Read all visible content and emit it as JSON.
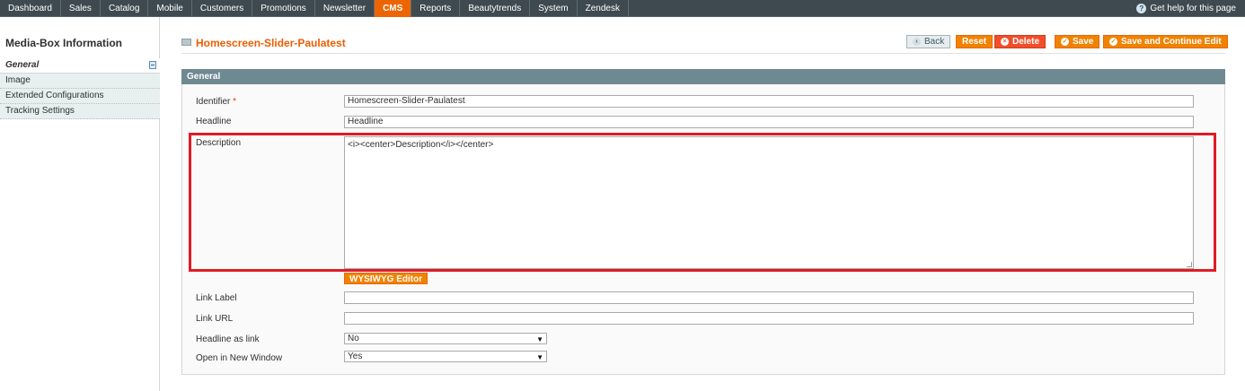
{
  "nav": {
    "items": [
      "Dashboard",
      "Sales",
      "Catalog",
      "Mobile",
      "Customers",
      "Promotions",
      "Newsletter",
      "CMS",
      "Reports",
      "Beautytrends",
      "System",
      "Zendesk"
    ],
    "active": "CMS",
    "help": "Get help for this page"
  },
  "sidebar": {
    "title": "Media-Box Information",
    "tabs": [
      "General",
      "Image",
      "Extended Configurations",
      "Tracking Settings"
    ]
  },
  "header": {
    "title": "Homescreen-Slider-Paulatest",
    "buttons": {
      "back": "Back",
      "reset": "Reset",
      "delete": "Delete",
      "save": "Save",
      "save_continue": "Save and Continue Edit"
    }
  },
  "form": {
    "section": "General",
    "identifier_label": "Identifier",
    "identifier_required": "*",
    "identifier_value": "Homescreen-Slider-Paulatest",
    "headline_label": "Headline",
    "headline_value": "Headline",
    "description_label": "Description",
    "description_value": "<i><center>Description</i></center>",
    "wysiwyg_label": "WYSIWYG Editor",
    "link_label_label": "Link Label",
    "link_label_value": "",
    "link_url_label": "Link URL",
    "link_url_value": "",
    "headline_as_link_label": "Headline as link",
    "headline_as_link_value": "No",
    "open_new_window_label": "Open in New Window",
    "open_new_window_value": "Yes"
  },
  "colors": {
    "nav_bg": "#3e4a4f",
    "accent": "#f18200",
    "title": "#eb5e00",
    "section_head": "#6f8992",
    "highlight": "#e01b24"
  }
}
